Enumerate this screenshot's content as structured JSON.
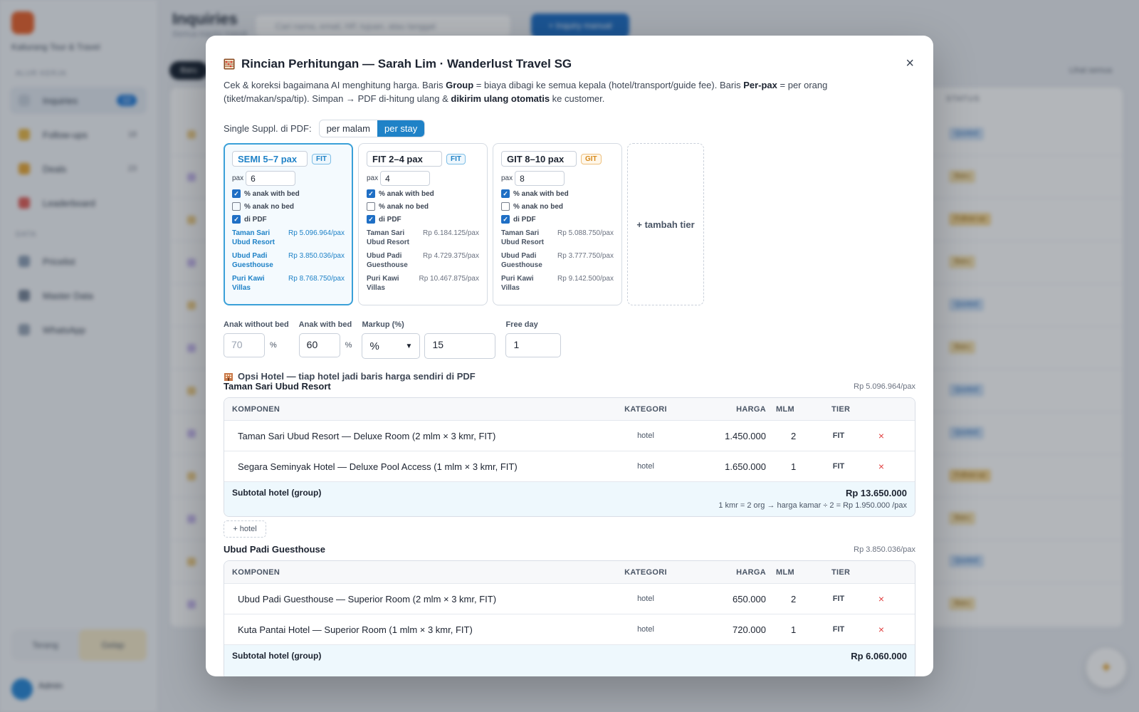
{
  "background": {
    "brand": "Kaliurang Tour & Travel",
    "section_main": "ALUR KERJA",
    "nav": [
      {
        "label": "Inquiries",
        "count": "12"
      },
      {
        "label": "Follow-ups",
        "count": "18"
      },
      {
        "label": "Deals",
        "count": "23"
      },
      {
        "label": "Leaderboard",
        "count": ""
      }
    ],
    "section_data": "DATA",
    "nav_data": [
      {
        "label": "Pricelist"
      },
      {
        "label": "Master Data"
      },
      {
        "label": "WhatsApp"
      }
    ],
    "bottom_left": "Terang",
    "bottom_right": "Gelap",
    "user": "Admin",
    "page_title": "Inquiries",
    "page_sub": "Semua inquiry masuk",
    "search_placeholder": "Cari nama, email, HP, tujuan, atau tanggal",
    "cta": "+ Inquiry manual",
    "chip": "Baru",
    "top_link": "Lihat semua",
    "status_col": "STATUS",
    "statuses": [
      "Quoted",
      "Baru",
      "Follow-up",
      "Baru",
      "Quoted",
      "Baru",
      "Quoted",
      "Quoted",
      "Follow-up",
      "Baru",
      "Quoted",
      "Baru"
    ]
  },
  "modal": {
    "title": "Rincian Perhitungan — Sarah Lim · Wanderlust Travel SG",
    "title_icon": "abacus-icon",
    "close": "×",
    "desc": {
      "p1": "Cek & koreksi bagaimana AI menghitung harga. Baris ",
      "b1": "Group",
      "p2": " = biaya dibagi ke semua kepala (hotel/transport/guide fee). Baris ",
      "b2": "Per-pax",
      "p3": " = per orang (tiket/makan/spa/tip). Simpan → PDF di-hitung ulang & ",
      "b3": "dikirim ulang otomatis",
      "p4": " ke customer."
    },
    "single_suppl_label": "Single Suppl. di PDF:",
    "single_suppl_options": [
      "per malam",
      "per stay"
    ],
    "single_suppl_selected": "per stay",
    "tiers": [
      {
        "name": "SEMI 5–7 pax",
        "badge": "FIT",
        "pax_label": "pax",
        "pax": "6",
        "selected": true,
        "checks": [
          {
            "label": "% anak with bed",
            "checked": true
          },
          {
            "label": "% anak no bed",
            "checked": false
          },
          {
            "label": "di PDF",
            "checked": true
          }
        ],
        "hotels": [
          {
            "name": "Taman Sari Ubud Resort",
            "price": "Rp 5.096.964/pax"
          },
          {
            "name": "Ubud Padi Guesthouse",
            "price": "Rp 3.850.036/pax"
          },
          {
            "name": "Puri Kawi Villas",
            "price": "Rp 8.768.750/pax"
          }
        ]
      },
      {
        "name": "FIT 2–4 pax",
        "badge": "FIT",
        "pax_label": "pax",
        "pax": "4",
        "selected": false,
        "checks": [
          {
            "label": "% anak with bed",
            "checked": true
          },
          {
            "label": "% anak no bed",
            "checked": false
          },
          {
            "label": "di PDF",
            "checked": true
          }
        ],
        "hotels": [
          {
            "name": "Taman Sari Ubud Resort",
            "price": "Rp 6.184.125/pax"
          },
          {
            "name": "Ubud Padi Guesthouse",
            "price": "Rp 4.729.375/pax"
          },
          {
            "name": "Puri Kawi Villas",
            "price": "Rp 10.467.875/pax"
          }
        ]
      },
      {
        "name": "GIT 8–10 pax",
        "badge": "GIT",
        "pax_label": "pax",
        "pax": "8",
        "selected": false,
        "checks": [
          {
            "label": "% anak with bed",
            "checked": true
          },
          {
            "label": "% anak no bed",
            "checked": false
          },
          {
            "label": "di PDF",
            "checked": true
          }
        ],
        "hotels": [
          {
            "name": "Taman Sari Ubud Resort",
            "price": "Rp 5.088.750/pax"
          },
          {
            "name": "Ubud Padi Guesthouse",
            "price": "Rp 3.777.750/pax"
          },
          {
            "name": "Puri Kawi Villas",
            "price": "Rp 9.142.500/pax"
          }
        ]
      }
    ],
    "add_tier": "+ tambah tier",
    "options": {
      "anak_without_bed": {
        "label": "Anak without bed",
        "placeholder": "70",
        "unit": "%"
      },
      "anak_with_bed": {
        "label": "Anak with bed",
        "value": "60",
        "unit": "%"
      },
      "markup": {
        "label": "Markup (%)",
        "type": "%",
        "value": "15"
      },
      "free_day": {
        "label": "Free day",
        "value": "1"
      }
    },
    "opsi_hotel_heading": "Opsi Hotel — tiap hotel jadi baris harga sendiri di PDF",
    "opsi_icon": "hotel-icon",
    "columns": [
      "KOMPONEN",
      "KATEGORI",
      "HARGA",
      "MLM",
      "TIER"
    ],
    "hotel_groups": [
      {
        "name": "Taman Sari Ubud Resort",
        "per_pax": "Rp 5.096.964/pax",
        "rows": [
          {
            "komponen": "Taman Sari Ubud Resort — Deluxe Room (2 mlm × 3 kmr, FIT)",
            "kategori": "hotel",
            "harga": "1.450.000",
            "mlm": "2",
            "tier": "FIT"
          },
          {
            "komponen": "Segara Seminyak Hotel — Deluxe Pool Access (1 mlm × 3 kmr, FIT)",
            "kategori": "hotel",
            "harga": "1.650.000",
            "mlm": "1",
            "tier": "FIT"
          }
        ],
        "subtotal_label": "Subtotal hotel (group)",
        "subtotal": "Rp 13.650.000",
        "note": "1 kmr = 2 org → harga kamar ÷ 2 = Rp 1.950.000 /pax",
        "add_label": "+ hotel"
      },
      {
        "name": "Ubud Padi Guesthouse",
        "per_pax": "Rp 3.850.036/pax",
        "rows": [
          {
            "komponen": "Ubud Padi Guesthouse — Superior Room (2 mlm × 3 kmr, FIT)",
            "kategori": "hotel",
            "harga": "650.000",
            "mlm": "2",
            "tier": "FIT"
          },
          {
            "komponen": "Kuta Pantai Hotel — Superior Room (1 mlm × 3 kmr, FIT)",
            "kategori": "hotel",
            "harga": "720.000",
            "mlm": "1",
            "tier": "FIT"
          }
        ],
        "subtotal_label": "Subtotal hotel (group)",
        "subtotal": "Rp 6.060.000"
      }
    ],
    "delete_glyph": "×"
  }
}
